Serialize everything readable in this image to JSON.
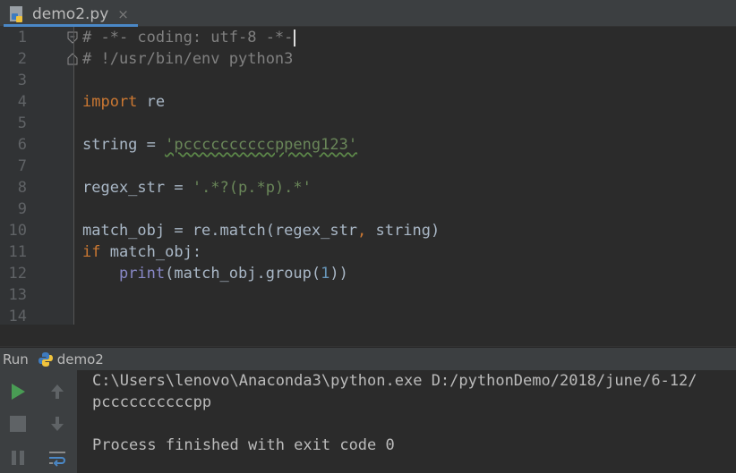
{
  "tab": {
    "filename": "demo2.py",
    "close_glyph": "×"
  },
  "editor": {
    "line_numbers": [
      "1",
      "2",
      "3",
      "4",
      "5",
      "6",
      "7",
      "8",
      "9",
      "10",
      "11",
      "12",
      "13",
      "14"
    ],
    "line1": "# -*- coding: utf-8 -*-",
    "line2": "# !/usr/bin/env python3",
    "line4": {
      "kw": "import",
      "rest": " re"
    },
    "line6": {
      "lhs": "string = ",
      "str": "'pccccccccccppeng123'"
    },
    "line8": {
      "lhs": "regex_str = ",
      "str": "'.*?(p.*p).*'"
    },
    "line10": {
      "a": "match_obj = re.match(regex_str",
      "comma": ",",
      "b": " string)"
    },
    "line11": {
      "kw": "if",
      "rest": " match_obj:"
    },
    "line12": {
      "indent": "    ",
      "fn": "print",
      "a": "(match_obj.group(",
      "num": "1",
      "b": "))"
    }
  },
  "run": {
    "label": "Run",
    "config_name": "demo2",
    "output": [
      "C:\\Users\\lenovo\\Anaconda3\\python.exe D:/pythonDemo/2018/june/6-12/",
      "pccccccccccpp",
      "",
      "Process finished with exit code 0"
    ]
  },
  "colors": {
    "keyword": "#cc7832",
    "string": "#6a8759",
    "comment": "#808080",
    "number": "#6897bb",
    "builtin": "#8888c6",
    "run_green": "#499c54"
  },
  "icons": [
    "python-file-icon",
    "close-icon",
    "fold-icon",
    "python-icon",
    "rerun-icon",
    "stop-icon",
    "pause-icon",
    "up-arrow-icon",
    "down-arrow-icon",
    "soft-wrap-icon"
  ]
}
